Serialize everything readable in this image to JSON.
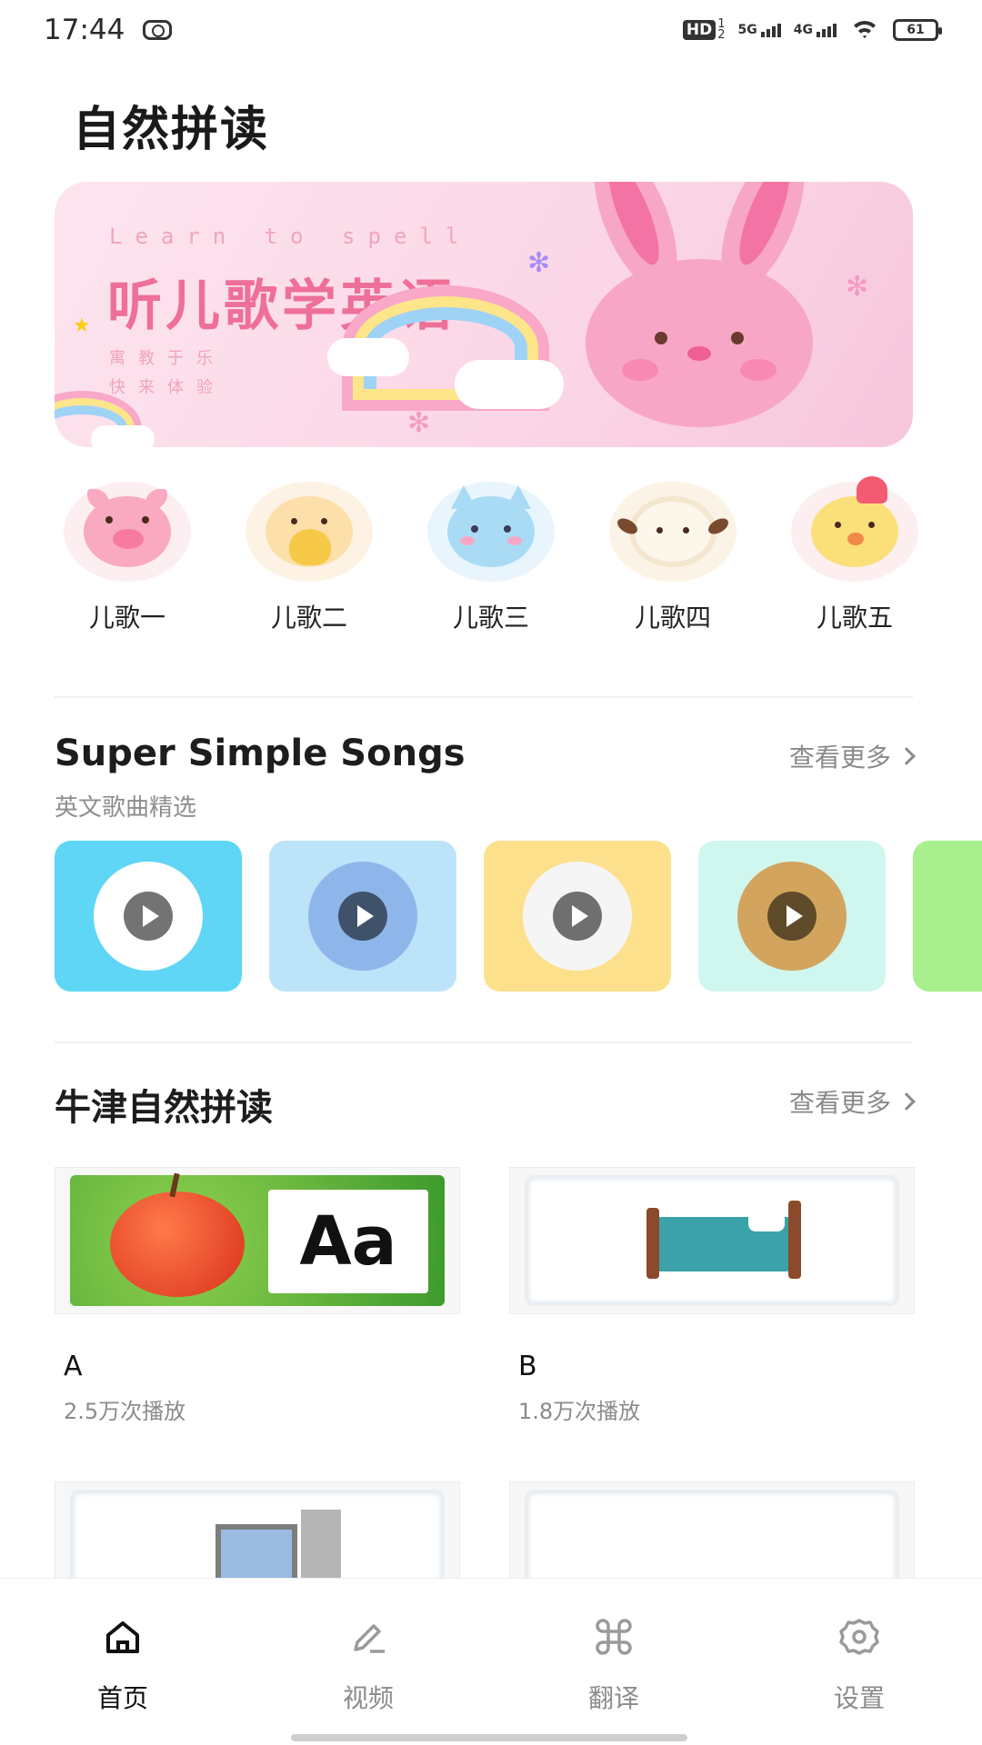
{
  "status_bar": {
    "time": "17:44",
    "hd": "HD",
    "hd_sub_top": "1",
    "hd_sub_bottom": "2",
    "net1": "5G",
    "net2": "4G",
    "battery": "61"
  },
  "page_title": "自然拼读",
  "banner": {
    "subtitle": "Learn to spell",
    "title": "听儿歌学英语",
    "line1": "寓教于乐",
    "line2": "快来体验"
  },
  "categories": [
    {
      "label": "儿歌一",
      "icon": "pig-icon"
    },
    {
      "label": "儿歌二",
      "icon": "chick-icon"
    },
    {
      "label": "儿歌三",
      "icon": "cat-icon"
    },
    {
      "label": "儿歌四",
      "icon": "sheep-icon"
    },
    {
      "label": "儿歌五",
      "icon": "rooster-icon"
    }
  ],
  "songs_section": {
    "title": "Super Simple Songs",
    "subtitle": "英文歌曲精选",
    "more": "查看更多"
  },
  "oxford_section": {
    "title": "牛津自然拼读",
    "more": "查看更多",
    "lessons": [
      {
        "letter": "A",
        "plays": "2.5万次播放"
      },
      {
        "letter": "B",
        "plays": "1.8万次播放"
      }
    ],
    "lesson_a_thumb_text": "Aa"
  },
  "tabs": [
    {
      "label": "首页",
      "icon": "home-icon",
      "active": true
    },
    {
      "label": "视频",
      "icon": "pencil-icon",
      "active": false
    },
    {
      "label": "翻译",
      "icon": "command-icon",
      "active": false
    },
    {
      "label": "设置",
      "icon": "gear-icon",
      "active": false
    }
  ],
  "colors": {
    "banner_title": "#ee6f98",
    "tab_active": "#111111",
    "tab_inactive": "#8b8b8b"
  }
}
